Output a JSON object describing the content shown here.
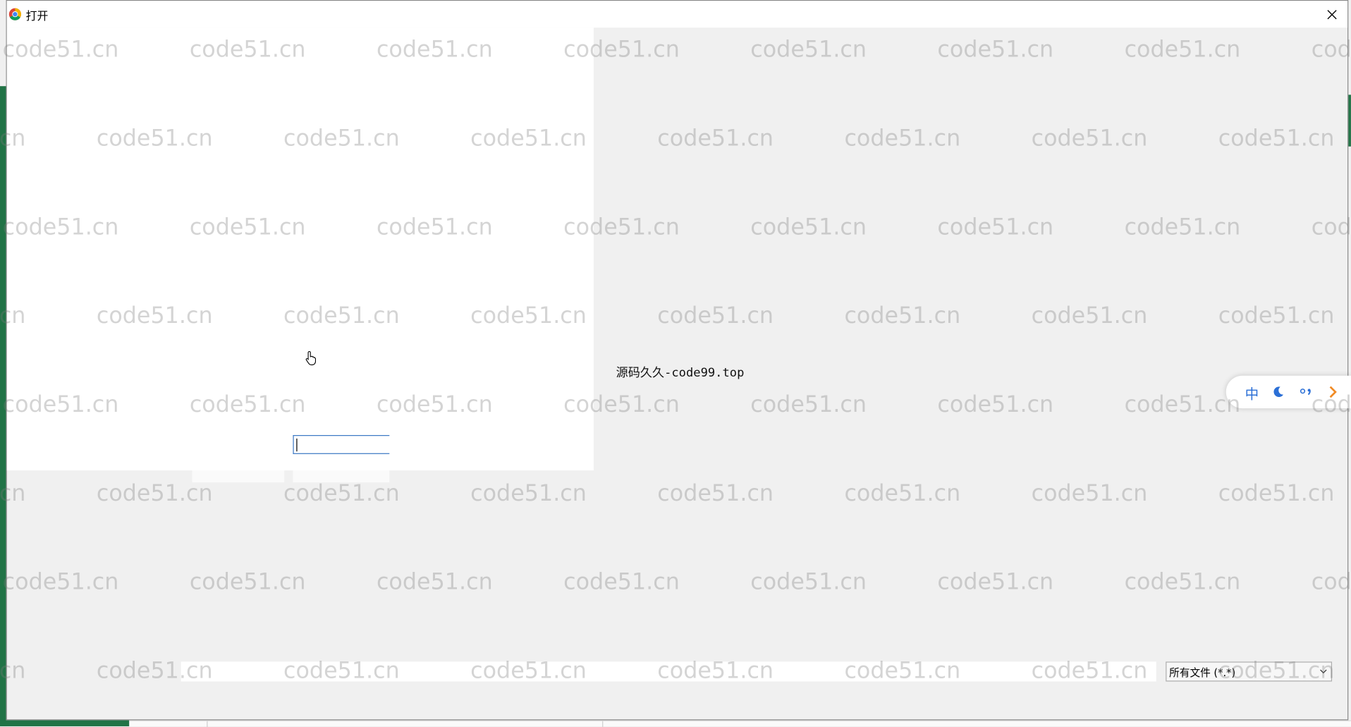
{
  "window": {
    "title": "打开"
  },
  "center_text": "源码久久-code99.top",
  "file_type_filter": {
    "selected": "所有文件 (*.*)"
  },
  "ime_toolbar": {
    "mode": "中"
  },
  "watermark": {
    "text": "code51.cn"
  }
}
